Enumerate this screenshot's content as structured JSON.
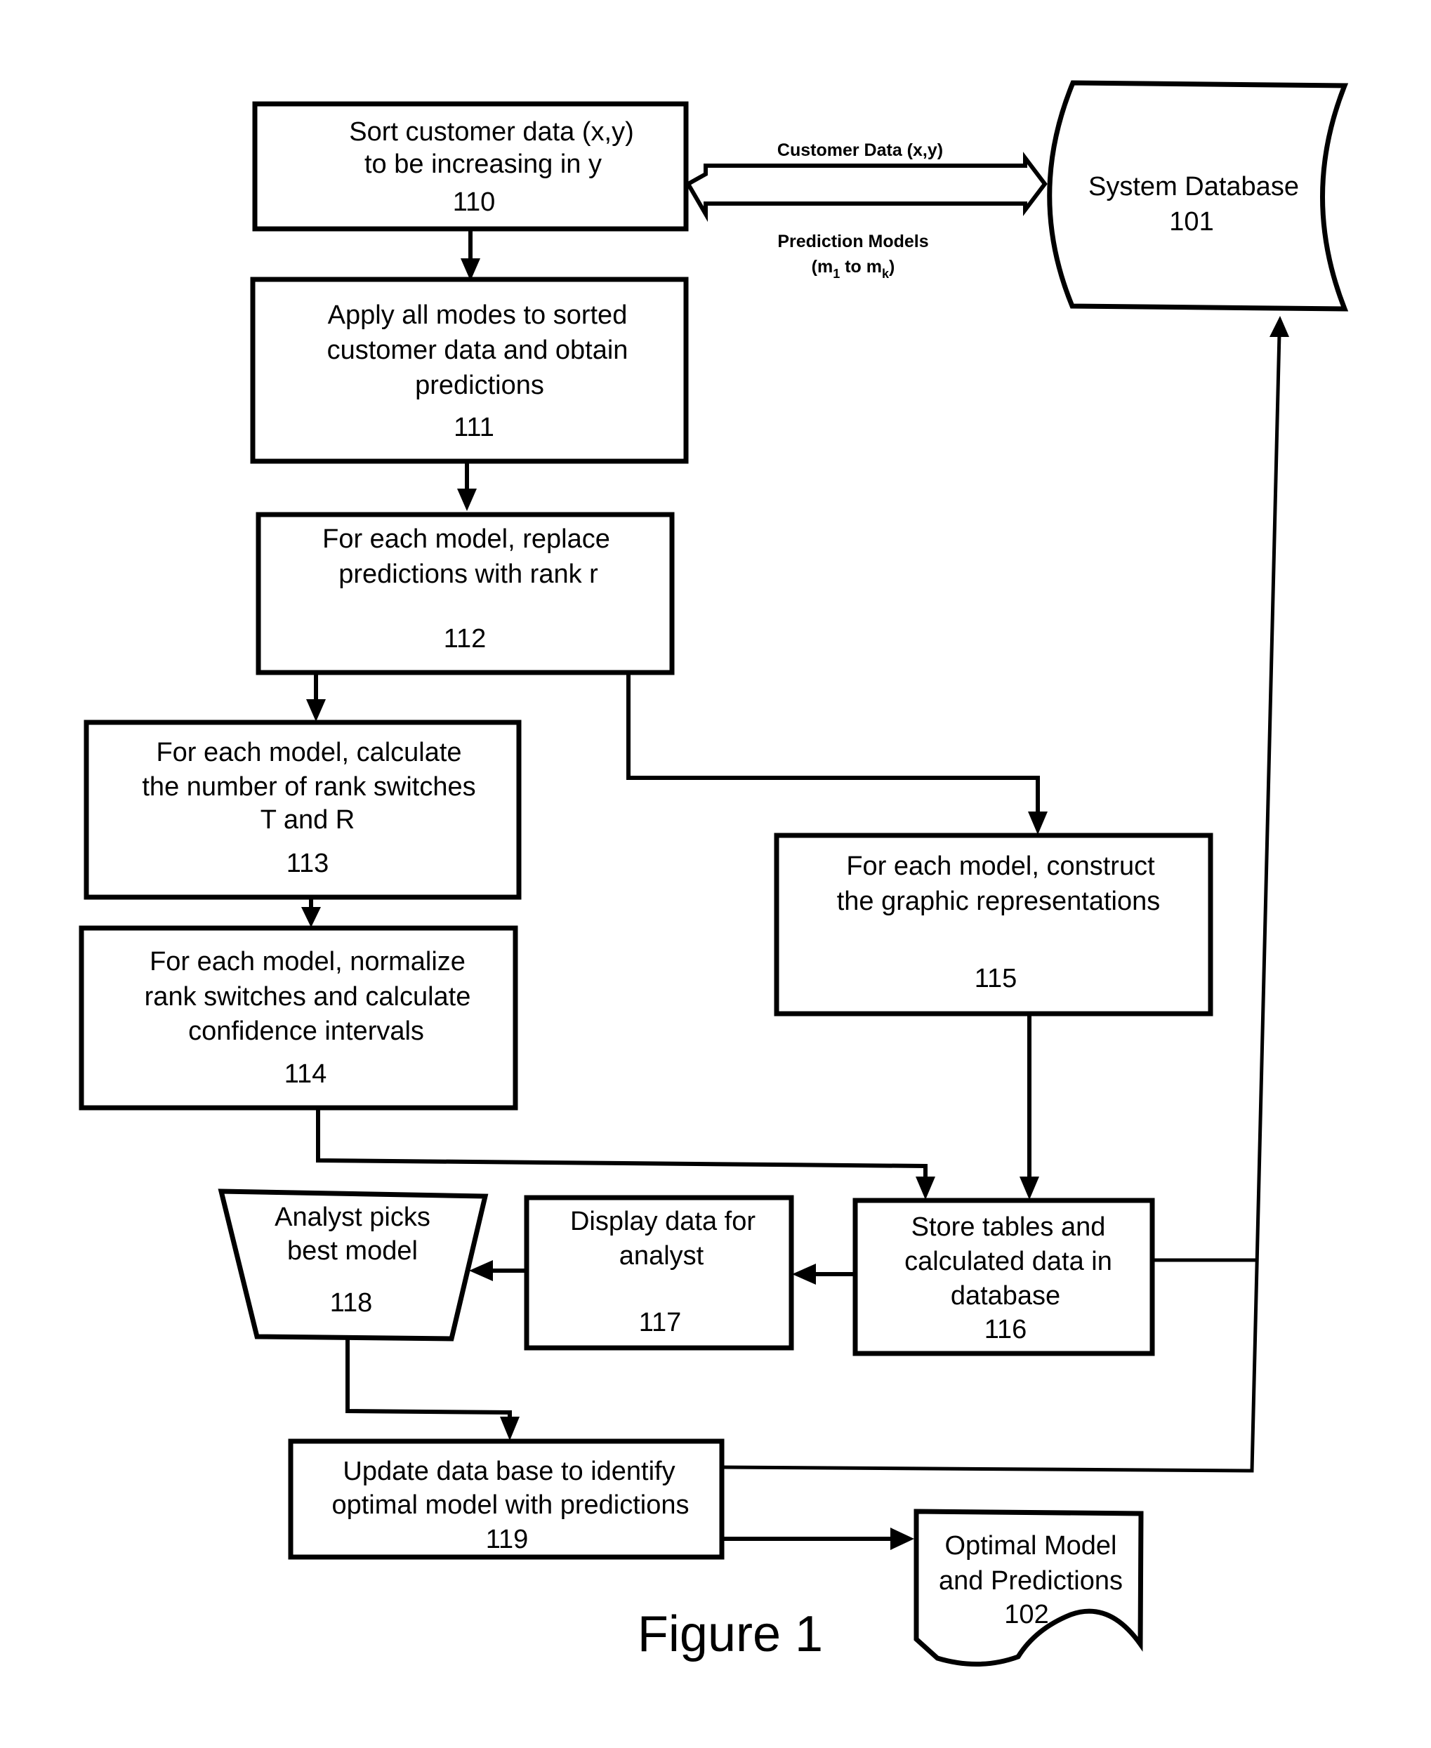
{
  "figure_label": "Figure 1",
  "colors": {
    "ink": "#000000",
    "background": "#ffffff"
  },
  "nodes": {
    "n110": {
      "lines": [
        "Sort customer data (x,y)",
        "to be increasing in y"
      ],
      "ref": "110",
      "shape": "process"
    },
    "n111": {
      "lines": [
        "Apply all modes to sorted",
        "customer data and obtain",
        "predictions"
      ],
      "ref": "111",
      "shape": "process"
    },
    "n112": {
      "lines": [
        "For each model, replace",
        "predictions with rank r"
      ],
      "ref": "112",
      "shape": "process"
    },
    "n113": {
      "lines": [
        "For each model, calculate",
        "the number of rank switches",
        "T and R"
      ],
      "ref": "113",
      "shape": "process"
    },
    "n114": {
      "lines": [
        "For each model, normalize",
        "rank switches and calculate",
        "confidence intervals"
      ],
      "ref": "114",
      "shape": "process"
    },
    "n115": {
      "lines": [
        "For each model, construct",
        "the graphic representations"
      ],
      "ref": "115",
      "shape": "process"
    },
    "n116": {
      "lines": [
        "Store tables and",
        "calculated data in",
        "database"
      ],
      "ref": "116",
      "shape": "process"
    },
    "n117": {
      "lines": [
        "Display data for",
        "analyst"
      ],
      "ref": "117",
      "shape": "process"
    },
    "n118": {
      "lines": [
        "Analyst picks",
        "best model"
      ],
      "ref": "118",
      "shape": "manual-operation"
    },
    "n119": {
      "lines": [
        "Update data base to identify",
        "optimal model with predictions"
      ],
      "ref": "119",
      "shape": "process"
    },
    "n101": {
      "lines": [
        "System Database"
      ],
      "ref": "101",
      "shape": "stored-data"
    },
    "n102": {
      "lines": [
        "Optimal Model",
        "and Predictions"
      ],
      "ref": "102",
      "shape": "document"
    }
  },
  "edge_labels": {
    "customer_data": "Customer Data (x,y)",
    "prediction_models": "Prediction Models",
    "models_range_open": "(m",
    "models_range_sub1": "1",
    "models_range_mid": " to m",
    "models_range_subk": "k",
    "models_range_close": ")"
  },
  "edges": [
    {
      "from": "110",
      "to": "101",
      "label": "Customer Data (x,y) / Prediction Models (m1 to mk)",
      "bidirectional": true
    },
    {
      "from": "110",
      "to": "111"
    },
    {
      "from": "111",
      "to": "112"
    },
    {
      "from": "112",
      "to": "113"
    },
    {
      "from": "112",
      "to": "115"
    },
    {
      "from": "113",
      "to": "114"
    },
    {
      "from": "114",
      "to": "116"
    },
    {
      "from": "115",
      "to": "116"
    },
    {
      "from": "116",
      "to": "117"
    },
    {
      "from": "116",
      "to": "101"
    },
    {
      "from": "117",
      "to": "118"
    },
    {
      "from": "118",
      "to": "119"
    },
    {
      "from": "119",
      "to": "101"
    },
    {
      "from": "119",
      "to": "102"
    }
  ]
}
